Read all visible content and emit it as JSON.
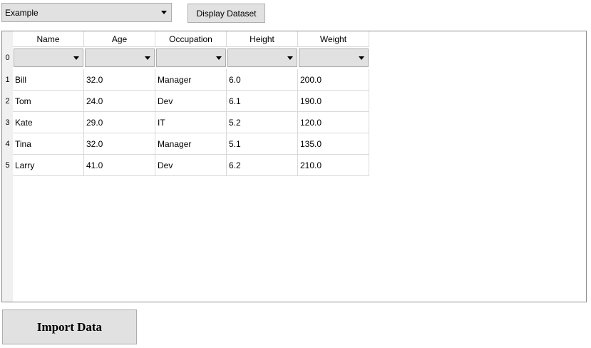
{
  "dataset_selector": {
    "value": "Example"
  },
  "display_button": {
    "label": "Display Dataset"
  },
  "import_button": {
    "label": "Import Data"
  },
  "table": {
    "columns": [
      "Name",
      "Age",
      "Occupation",
      "Height",
      "Weight"
    ],
    "index": [
      "0",
      "1",
      "2",
      "3",
      "4",
      "5"
    ],
    "rows": [
      [
        "Bill",
        "32.0",
        "Manager",
        "6.0",
        "200.0"
      ],
      [
        "Tom",
        "24.0",
        "Dev",
        "6.1",
        "190.0"
      ],
      [
        "Kate",
        "29.0",
        "IT",
        "5.2",
        "120.0"
      ],
      [
        "Tina",
        "32.0",
        "Manager",
        "5.1",
        "135.0"
      ],
      [
        "Larry",
        "41.0",
        "Dev",
        "6.2",
        "210.0"
      ]
    ]
  }
}
